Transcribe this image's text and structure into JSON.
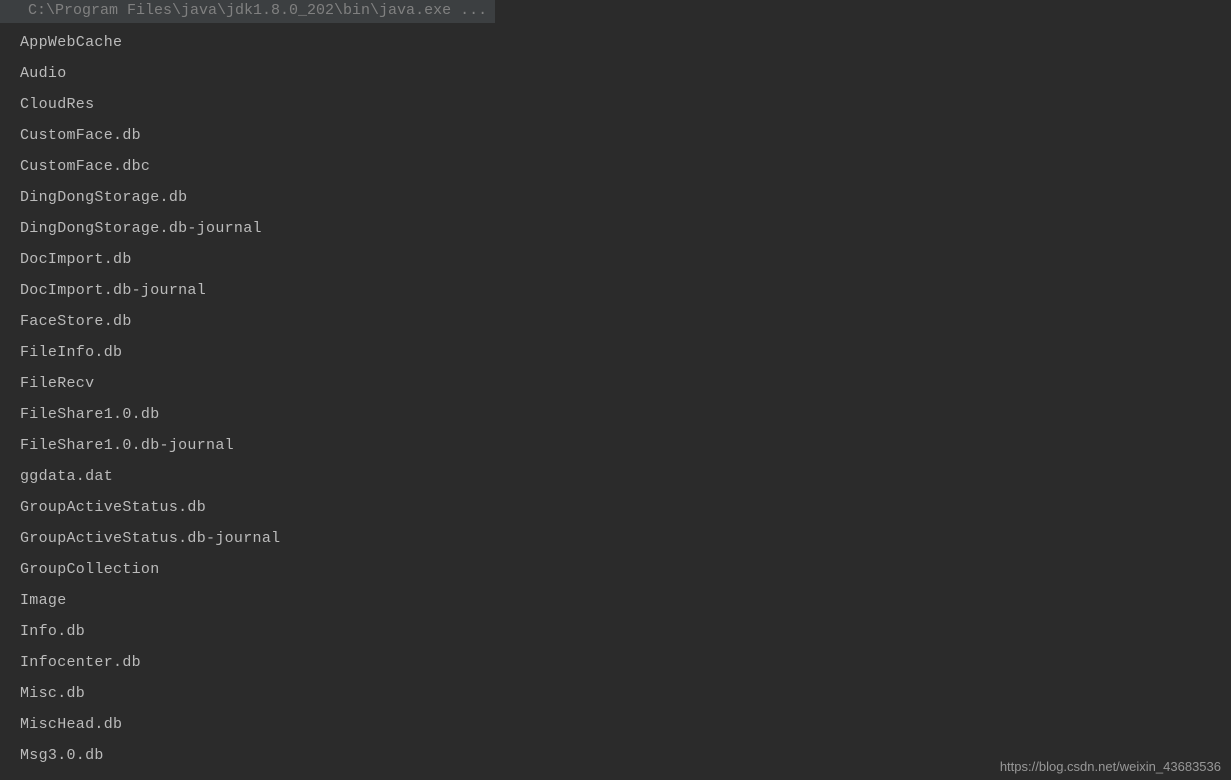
{
  "command_line": "C:\\Program Files\\java\\jdk1.8.0_202\\bin\\java.exe  ...",
  "output_lines": [
    "AppWebCache",
    "Audio",
    "CloudRes",
    "CustomFace.db",
    "CustomFace.dbc",
    "DingDongStorage.db",
    "DingDongStorage.db-journal",
    "DocImport.db",
    "DocImport.db-journal",
    "FaceStore.db",
    "FileInfo.db",
    "FileRecv",
    "FileShare1.0.db",
    "FileShare1.0.db-journal",
    "ggdata.dat",
    "GroupActiveStatus.db",
    "GroupActiveStatus.db-journal",
    "GroupCollection",
    "Image",
    "Info.db",
    "Infocenter.db",
    "Misc.db",
    "MiscHead.db",
    "Msg3.0.db"
  ],
  "watermark": "https://blog.csdn.net/weixin_43683536"
}
